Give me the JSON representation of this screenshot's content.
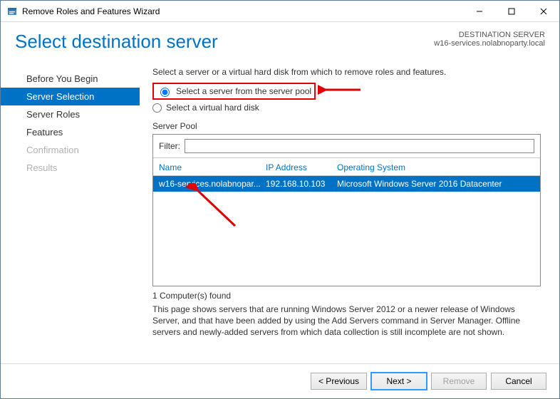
{
  "window": {
    "title": "Remove Roles and Features Wizard"
  },
  "header": {
    "page_title": "Select destination server",
    "destination_heading": "DESTINATION SERVER",
    "destination_value": "w16-services.nolabnoparty.local"
  },
  "nav": {
    "items": [
      {
        "label": "Before You Begin",
        "state": "normal"
      },
      {
        "label": "Server Selection",
        "state": "active"
      },
      {
        "label": "Server Roles",
        "state": "normal"
      },
      {
        "label": "Features",
        "state": "normal"
      },
      {
        "label": "Confirmation",
        "state": "disabled"
      },
      {
        "label": "Results",
        "state": "disabled"
      }
    ]
  },
  "main": {
    "instruction": "Select a server or a virtual hard disk from which to remove roles and features.",
    "radio1": "Select a server from the server pool",
    "radio2": "Select a virtual hard disk",
    "section_label": "Server Pool",
    "filter_label": "Filter:",
    "filter_value": "",
    "columns": {
      "name": "Name",
      "ip": "IP Address",
      "os": "Operating System"
    },
    "rows": [
      {
        "name": "w16-services.nolabnopar...",
        "ip": "192.168.10.103",
        "os": "Microsoft Windows Server 2016 Datacenter"
      }
    ],
    "found_text": "1 Computer(s) found",
    "explain_text": "This page shows servers that are running Windows Server 2012 or a newer release of Windows Server, and that have been added by using the Add Servers command in Server Manager. Offline servers and newly-added servers from which data collection is still incomplete are not shown."
  },
  "footer": {
    "previous": "< Previous",
    "next": "Next >",
    "remove": "Remove",
    "cancel": "Cancel"
  }
}
